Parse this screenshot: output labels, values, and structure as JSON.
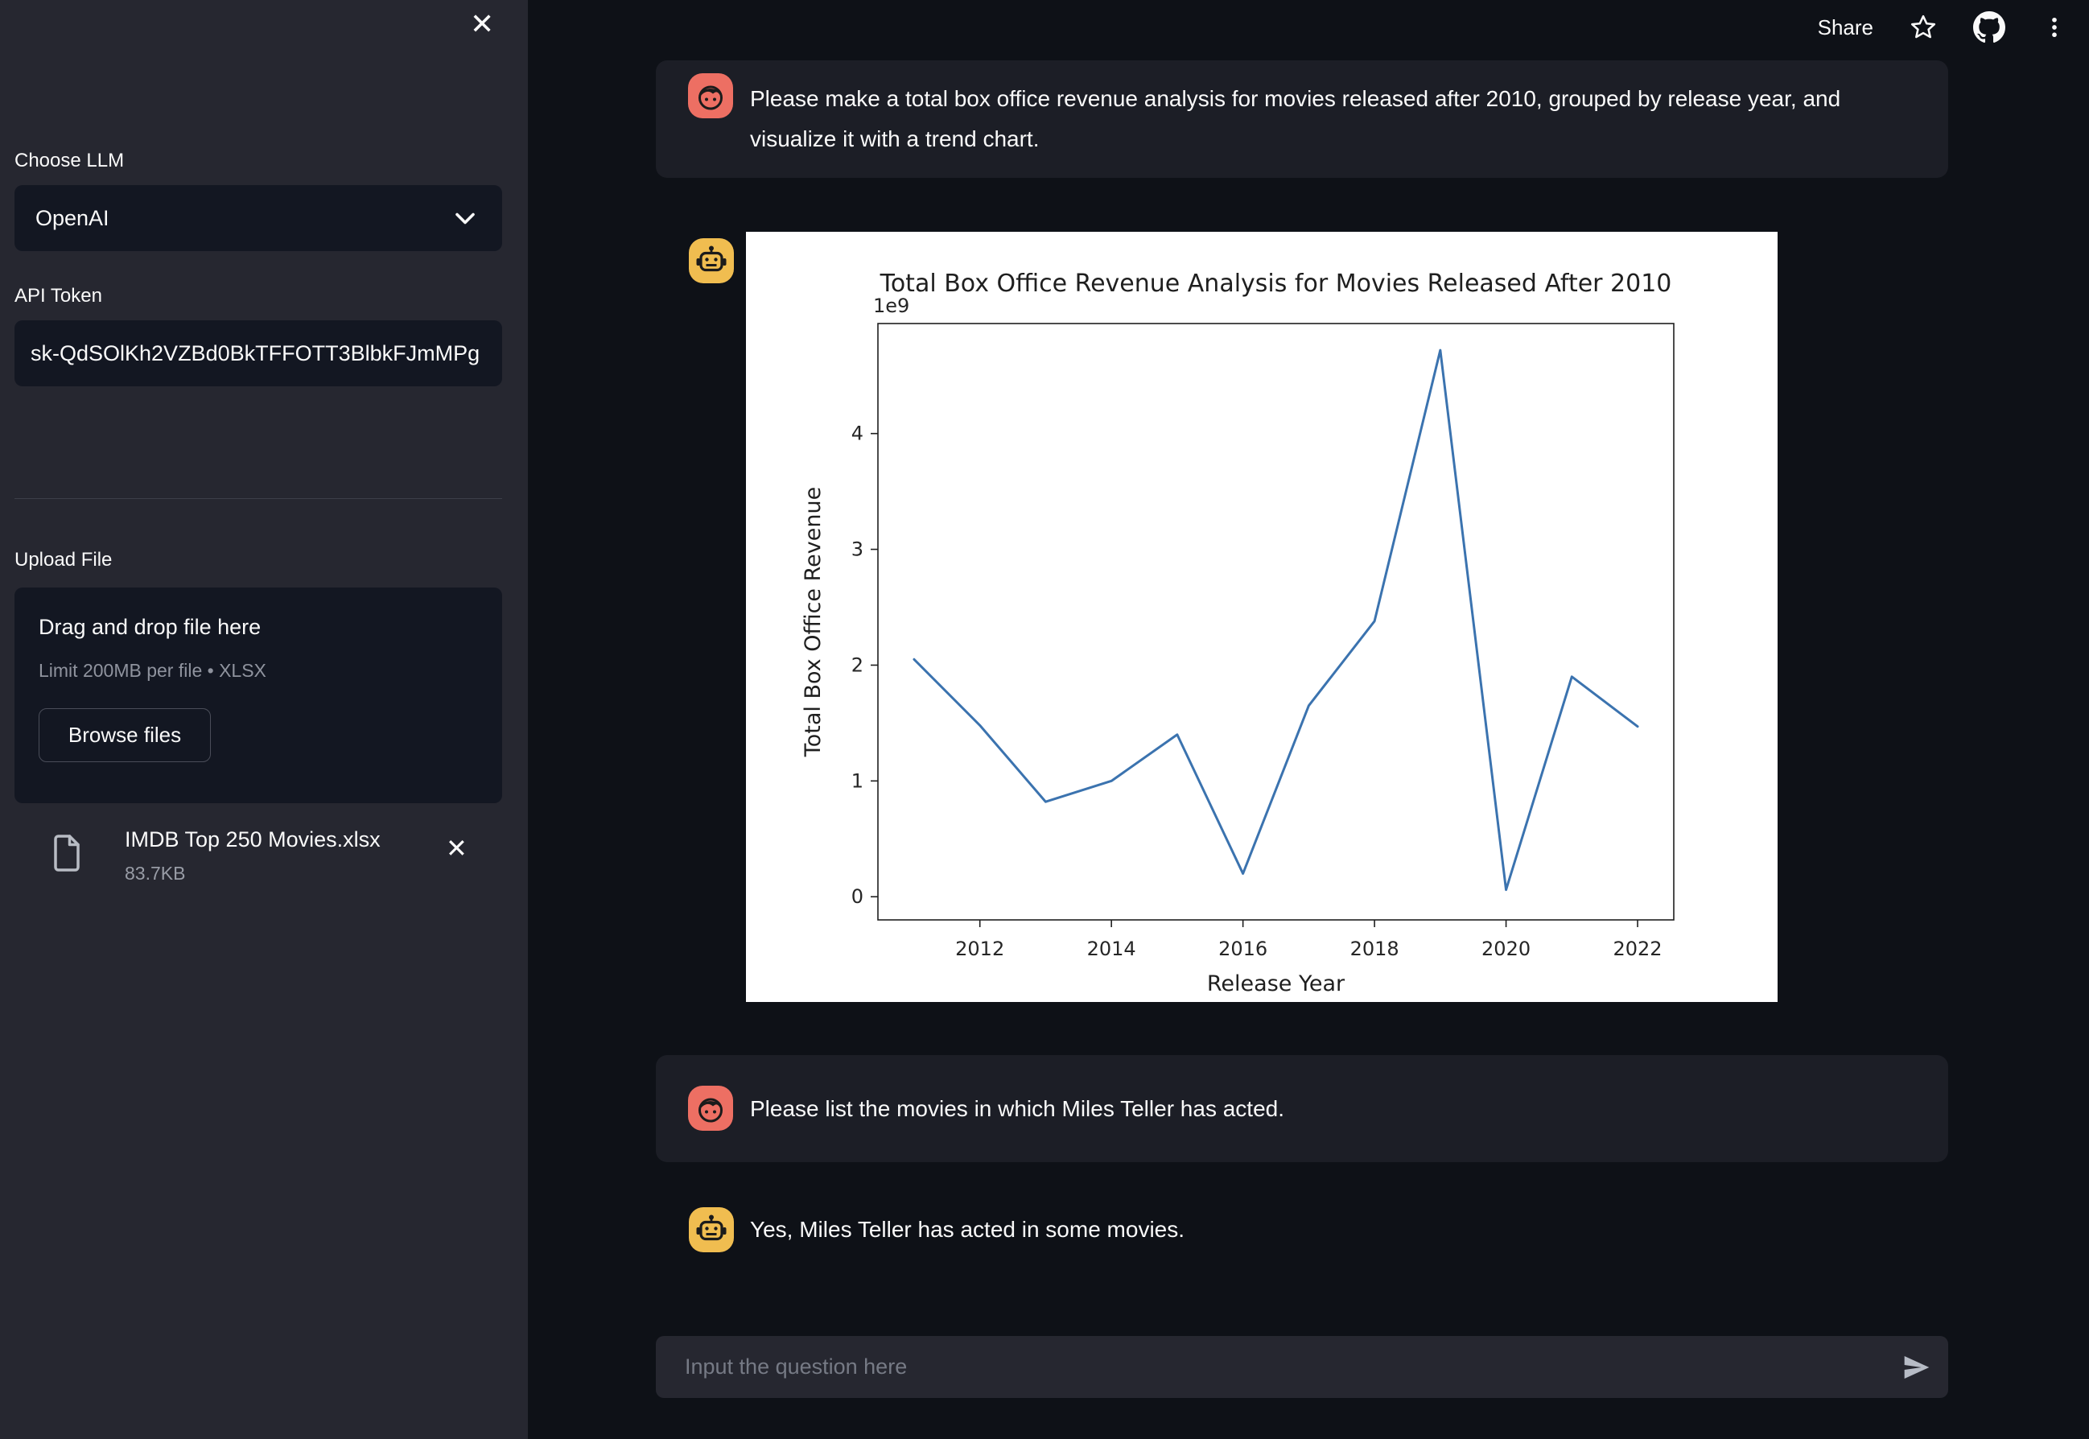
{
  "colors": {
    "page_background": "#0e1117",
    "sidebar_background": "#262730",
    "widget_background": "#131722",
    "bubble_background": "#1c1e26",
    "user_avatar": "#ed6f63",
    "assistant_avatar": "#f0bd50",
    "chart_line": "#3b73af",
    "text_primary": "#fafafa",
    "text_muted": "#8f939e"
  },
  "icons": {
    "close": "✕",
    "remove_file": "✕",
    "chevron_down": "chevron-down",
    "document": "file-outline",
    "star": "star-outline",
    "github": "github-logo",
    "kebab": "vertical-dots",
    "send": "send-arrow",
    "user_avatar": "person-face",
    "assistant_avatar": "robot-face"
  },
  "sidebar": {
    "choose_llm_label": "Choose LLM",
    "llm_value": "OpenAI",
    "api_token_label": "API Token",
    "api_token_value": "sk-QdSOlKh2VZBd0BkTFFOTT3BlbkFJmMPg",
    "upload_file_label": "Upload File",
    "dropzone_title": "Drag and drop file here",
    "dropzone_limit": "Limit 200MB per file • XLSX",
    "browse_button_label": "Browse files",
    "uploaded_file_name": "IMDB Top 250 Movies.xlsx",
    "uploaded_file_size": "83.7KB"
  },
  "header": {
    "share_label": "Share"
  },
  "chat": {
    "messages": [
      {
        "role": "user",
        "text": "Please make a total box office revenue analysis for movies released after 2010, grouped by release year, and visualize it with a trend chart."
      },
      {
        "role": "assistant",
        "type": "chart"
      },
      {
        "role": "user",
        "text": "Please list the movies in which Miles Teller has acted."
      },
      {
        "role": "assistant",
        "text": "Yes, Miles Teller has acted in some movies."
      }
    ],
    "input_placeholder": "Input the question here"
  },
  "chart_data": {
    "type": "line",
    "title": "Total Box Office Revenue Analysis for Movies Released After 2010",
    "xlabel": "Release Year",
    "ylabel": "Total Box Office Revenue",
    "offset_label": "1e9",
    "x": [
      2011,
      2012,
      2013,
      2014,
      2015,
      2016,
      2017,
      2018,
      2019,
      2020,
      2021,
      2022
    ],
    "values": [
      2.05,
      1.48,
      0.82,
      1.0,
      1.4,
      0.2,
      1.65,
      2.38,
      4.72,
      0.06,
      1.9,
      1.47
    ],
    "unit": "1e9 (billions of dollars)",
    "xticks": [
      2012,
      2014,
      2016,
      2018,
      2020,
      2022
    ],
    "yticks": [
      0,
      1,
      2,
      3,
      4
    ],
    "xlim": [
      2010.45,
      2022.55
    ],
    "ylim": [
      -0.2,
      4.95
    ],
    "grid": false,
    "legend": "none",
    "line_color": "#3b73af",
    "background": "#ffffff"
  }
}
